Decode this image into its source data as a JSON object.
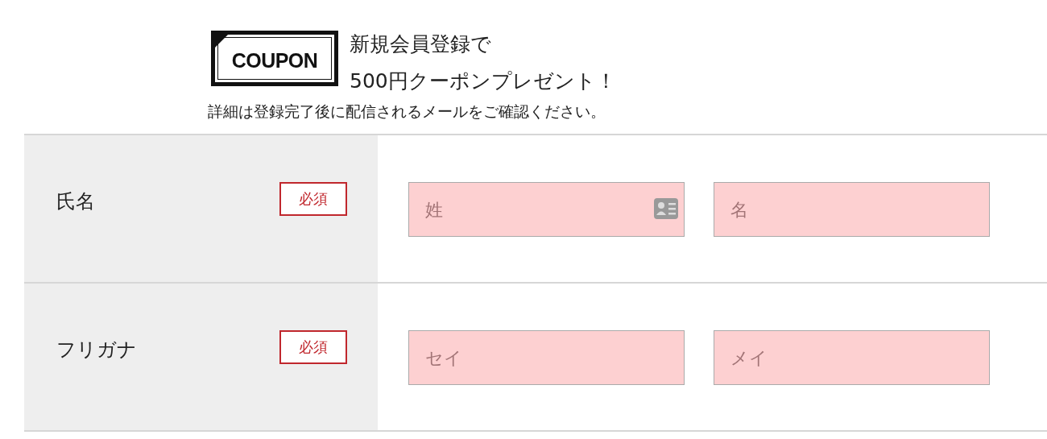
{
  "promo": {
    "badge": "COUPON",
    "headline_lines": [
      "新規会員登録で",
      "500円クーポンプレゼント！"
    ],
    "note": "詳細は登録完了後に配信されるメールをご確認ください。"
  },
  "form_rows": [
    {
      "label": "氏名",
      "required_badge": "必須",
      "fields": [
        {
          "placeholder": "姓",
          "contact_icon": true
        },
        {
          "placeholder": "名",
          "contact_icon": false
        }
      ]
    },
    {
      "label": "フリガナ",
      "required_badge": "必須",
      "fields": [
        {
          "placeholder": "セイ",
          "contact_icon": false
        },
        {
          "placeholder": "メイ",
          "contact_icon": false
        }
      ]
    }
  ]
}
